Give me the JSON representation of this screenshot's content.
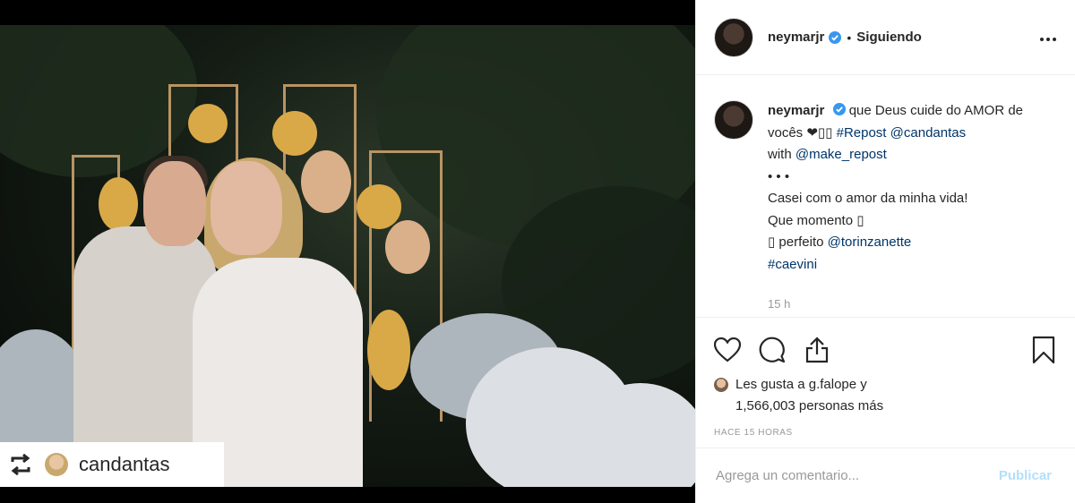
{
  "post": {
    "image_alt": "",
    "repost_badge": {
      "username": "candantas"
    }
  },
  "header": {
    "username": "neymarjr",
    "separator": "•",
    "follow_status": "Siguiendo",
    "more_icon": "more-options-icon"
  },
  "caption": {
    "username": "neymarjr",
    "line1_text": "que Deus cuide do AMOR de vocês ❤▯▯",
    "hashtag_repost": "#Repost",
    "mention_candantas": "@candantas",
    "with_text": "with",
    "mention_make_repost": "@make_repost",
    "dots": "• • •",
    "line_casei": "Casei com o amor da minha vida!",
    "line_momento": "Que momento ▯",
    "line_perfeito_prefix": "▯ perfeito",
    "mention_torinzanette": "@torinzanette",
    "hashtag_caevini": "#caevini",
    "time": "15 h"
  },
  "actions": {
    "like_icon": "heart-icon",
    "comment_icon": "comment-icon",
    "share_icon": "share-icon",
    "save_icon": "bookmark-icon"
  },
  "likes": {
    "line1": "Les gusta a g.falope y",
    "line2": "1,566,003 personas más"
  },
  "timestamp": "HACE 15 HORAS",
  "comment_box": {
    "placeholder": "Agrega un comentario...",
    "publish_label": "Publicar"
  },
  "colors": {
    "link": "#003569",
    "verified": "#3897f0",
    "muted": "#999999",
    "publish_disabled": "#b2dffc"
  }
}
